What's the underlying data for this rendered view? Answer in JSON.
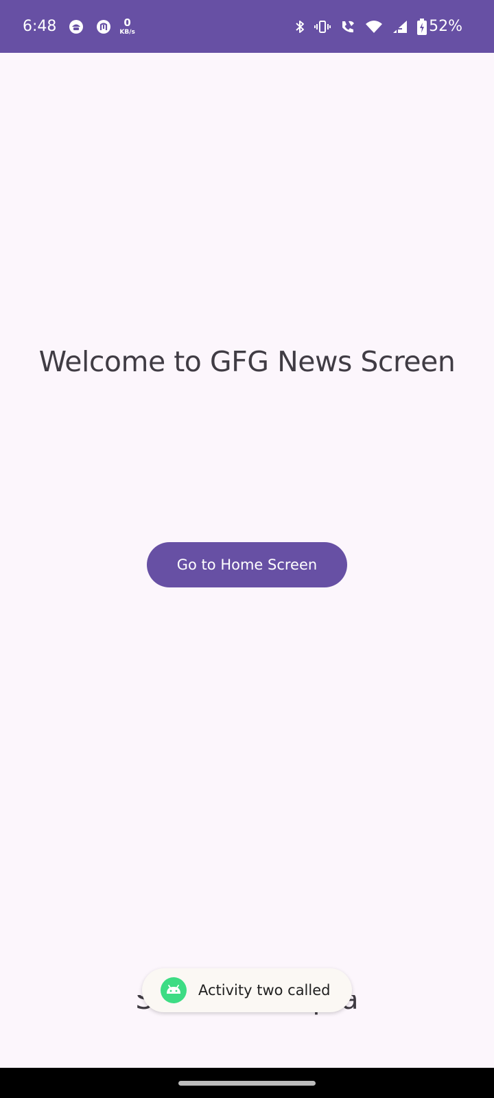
{
  "status_bar": {
    "time": "6:48",
    "network_speed_value": "0",
    "network_speed_unit": "KB/s",
    "battery_percent": "52%",
    "icons": [
      "app-notification-icon",
      "n-app-icon",
      "bluetooth-icon",
      "vibrate-icon",
      "wifi-call-icon",
      "wifi-icon",
      "signal-icon",
      "battery-charging-icon"
    ],
    "background_color": "#6750A4"
  },
  "main": {
    "title": "Welcome to GFG News Screen",
    "button_label": "Go to Home Screen",
    "footer_name": "Saksham Gupta"
  },
  "toast": {
    "message": "Activity two called",
    "icon": "android-icon"
  },
  "colors": {
    "accent": "#6750A4",
    "background": "#FCF6FC",
    "text": "#403C44"
  }
}
